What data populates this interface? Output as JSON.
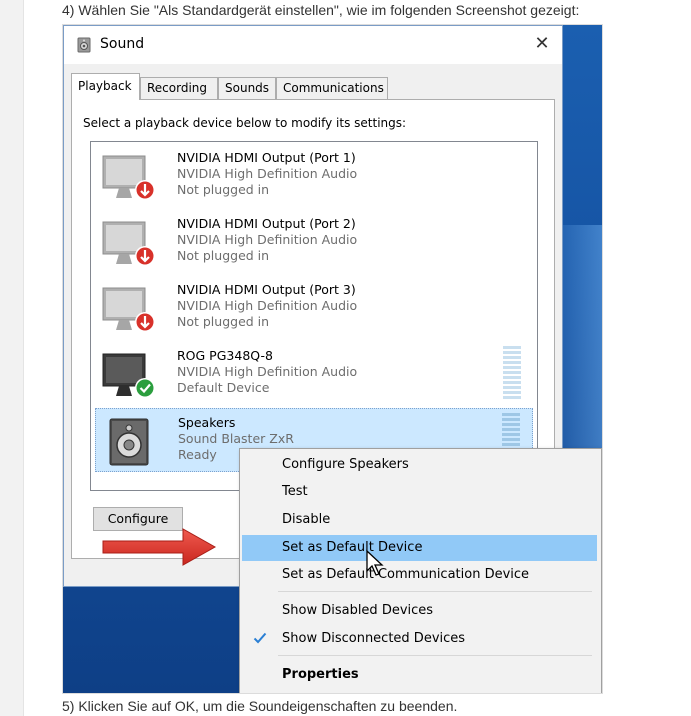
{
  "page": {
    "instruction_top": "4) Wählen Sie \"Als Standardgerät einstellen\", wie im folgenden Screenshot gezeigt:",
    "instruction_bottom": "5) Klicken Sie auf OK, um die Soundeigenschaften zu beenden."
  },
  "dialog": {
    "title": "Sound",
    "close_glyph": "✕",
    "tabs": [
      {
        "label": "Playback",
        "active": true
      },
      {
        "label": "Recording",
        "active": false
      },
      {
        "label": "Sounds",
        "active": false
      },
      {
        "label": "Communications",
        "active": false
      }
    ],
    "hint": "Select a playback device below to modify its settings:",
    "devices": [
      {
        "name": "NVIDIA HDMI Output (Port 1)",
        "driver": "NVIDIA High Definition Audio",
        "status": "Not plugged in",
        "icon": "monitor-icon",
        "badge": "red-down-arrow-badge"
      },
      {
        "name": "NVIDIA HDMI Output (Port 2)",
        "driver": "NVIDIA High Definition Audio",
        "status": "Not plugged in",
        "icon": "monitor-icon",
        "badge": "red-down-arrow-badge"
      },
      {
        "name": "NVIDIA HDMI Output (Port 3)",
        "driver": "NVIDIA High Definition Audio",
        "status": "Not plugged in",
        "icon": "monitor-icon",
        "badge": "red-down-arrow-badge"
      },
      {
        "name": "ROG PG348Q-8",
        "driver": "NVIDIA High Definition Audio",
        "status": "Default Device",
        "icon": "monitor-icon",
        "badge": "green-check-badge"
      },
      {
        "name": "Speakers",
        "driver": "Sound Blaster ZxR",
        "status": "Ready",
        "icon": "speaker-icon",
        "selected": true
      }
    ],
    "configure_label": "Configure"
  },
  "context_menu": {
    "items": [
      {
        "label": "Configure Speakers"
      },
      {
        "label": "Test"
      },
      {
        "label": "Disable"
      },
      {
        "label": "Set as Default Device",
        "highlighted": true
      },
      {
        "label": "Set as Default Communication Device"
      },
      {
        "label": "Show Disabled Devices"
      },
      {
        "label": "Show Disconnected Devices",
        "checked": true
      },
      {
        "label": "Properties",
        "bold": true
      }
    ]
  },
  "colors": {
    "menu_highlight": "#91c9f7",
    "selected_row": "#cce8ff",
    "arrow_red": "#e8423a",
    "check_blue": "#2a7fd4",
    "desktop_blue": "#1553a3"
  }
}
